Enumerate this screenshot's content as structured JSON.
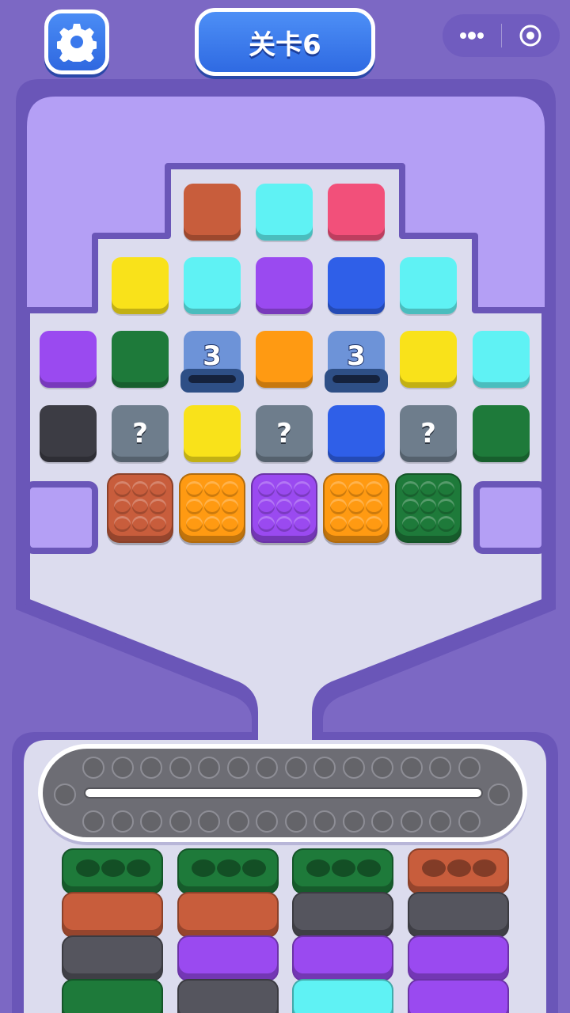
{
  "header": {
    "level_label": "关卡6",
    "settings_icon": "gear-icon",
    "menu_icon": "more-dots-icon",
    "close_icon": "target-circle-icon"
  },
  "colors": {
    "background": "#7c68c4",
    "board_outer": "#b49ff5",
    "board_inner": "#dcdcee",
    "board_border": "#6a56b8"
  },
  "board": {
    "row1": [
      "#c85d3c",
      "#5ff2f4",
      "#f2507a"
    ],
    "row2": [
      "#f9e21a",
      "#5ff2f4",
      "#9a4af0",
      "#2f5fe8",
      "#5ff2f4"
    ],
    "row3": [
      {
        "color": "#9a4af0"
      },
      {
        "color": "#1e7a3a"
      },
      {
        "counter": "3"
      },
      {
        "color": "#ff9a12"
      },
      {
        "counter": "3"
      },
      {
        "color": "#f9e21a"
      },
      {
        "color": "#5ff2f4"
      }
    ],
    "row4": [
      {
        "color": "#3c3c44"
      },
      {
        "mystery": "?"
      },
      {
        "color": "#f9e21a"
      },
      {
        "mystery": "?"
      },
      {
        "color": "#2f5fe8"
      },
      {
        "mystery": "?"
      },
      {
        "color": "#1e7a3a"
      }
    ],
    "blocks": [
      "#c85d3c",
      "#ff9a12",
      "#9a4af0",
      "#ff9a12",
      "#1e7a3a"
    ]
  },
  "conveyor": {
    "holes_per_row": 14
  },
  "trays": [
    [
      "#1e7a3a",
      "#c85d3c",
      "#55555e",
      "#1e7a3a"
    ],
    [
      "#1e7a3a",
      "#c85d3c",
      "#9a4af0",
      "#55555e"
    ],
    [
      "#1e7a3a",
      "#55555e",
      "#9a4af0",
      "#5ff2f4"
    ],
    [
      "#c85d3c",
      "#55555e",
      "#9a4af0",
      "#9a4af0"
    ]
  ]
}
